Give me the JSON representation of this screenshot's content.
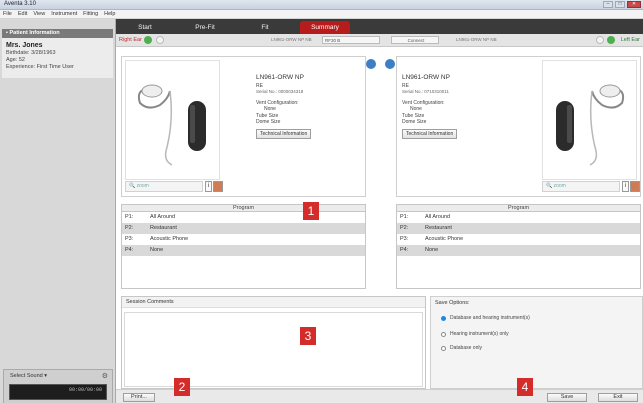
{
  "window": {
    "title": "Aventa 3.10"
  },
  "menu": [
    "File",
    "Edit",
    "View",
    "Instrument",
    "Fitting",
    "Help"
  ],
  "sidebar": {
    "header": "Patient Information",
    "patient": {
      "name": "Mrs. Jones",
      "birthdate": "Birthdate: 3/28/1963",
      "age": "Age: 52",
      "experience": "Experience: First Time User"
    },
    "player": {
      "select_label": "Select Sound",
      "time": "00:00/00:00"
    }
  },
  "tabs": [
    {
      "label": "Start",
      "active": false
    },
    {
      "label": "Pre-Fit",
      "active": false
    },
    {
      "label": "Fit",
      "active": false
    },
    {
      "label": "Summary",
      "active": true
    }
  ],
  "controlbar": {
    "right_label": "Right Ear",
    "left_label": "Left Ear",
    "program_label": "LN961-ORW NP NB",
    "program_value": "RF30 B",
    "button_label": "Connect",
    "program_label_right": "LN961-ORW NP NB"
  },
  "devices": {
    "right": {
      "model": "LN961-ORW NP",
      "sub": "RE",
      "serial": "Serial No.: 0000034318",
      "vent_label": "Vent Configuration:",
      "vent_value": "None",
      "tube": "Tube Size",
      "dome": "Dome Size",
      "tech_btn": "Technical Information",
      "zoom": "zoom"
    },
    "left": {
      "model": "LN961-ORW NP",
      "sub": "RE",
      "serial": "Serial No.: 0710310011",
      "vent_label": "Vent Configuration:",
      "vent_value": "None",
      "tube": "Tube Size",
      "dome": "Dome Size",
      "tech_btn": "Technical Information",
      "zoom": "zoom"
    }
  },
  "programs": {
    "header": "Program",
    "rows": [
      {
        "code": "P1:",
        "name": "All Around"
      },
      {
        "code": "P2:",
        "name": "Restaurant"
      },
      {
        "code": "P3:",
        "name": "Acoustic Phone"
      },
      {
        "code": "P4:",
        "name": "None"
      }
    ]
  },
  "callouts": {
    "one": "1",
    "two": "2",
    "three": "3",
    "four": "4"
  },
  "comments": {
    "title": "Session Comments"
  },
  "save_options": {
    "title": "Save Options:",
    "opt1": "Database and hearing instrument(s)",
    "opt2": "Hearing instrument(s) only",
    "opt3": "Database only",
    "selected": "opt1"
  },
  "buttons": {
    "print": "Print...",
    "save": "Save",
    "exit": "Exit"
  },
  "colors": {
    "accent_red": "#b71c1c",
    "callout_red": "#d42b2b",
    "fit_green": "#4caf50",
    "radio_blue": "#1e88e5"
  }
}
